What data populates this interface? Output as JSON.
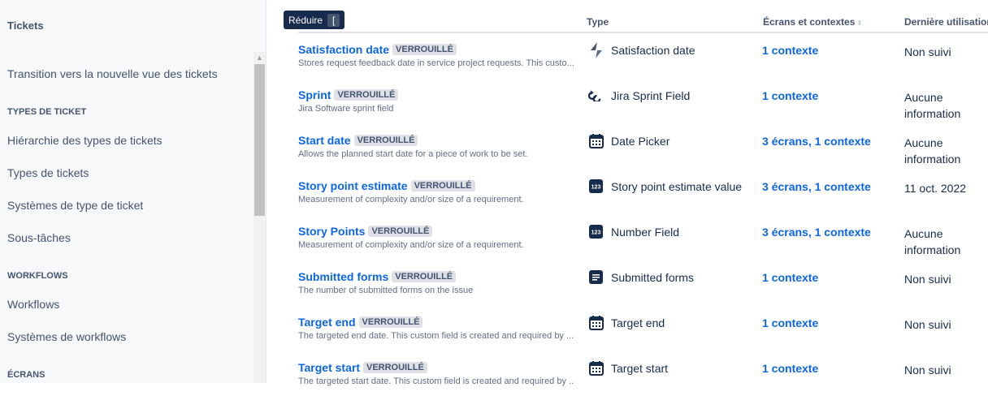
{
  "sidebar": {
    "title": "Tickets",
    "items": [
      "Transition vers la nouvelle vue des tickets"
    ],
    "sections": [
      {
        "heading": "TYPES DE TICKET",
        "items": [
          "Hiérarchie des types de tickets",
          "Types de tickets",
          "Systèmes de type de ticket",
          "Sous-tâches"
        ]
      },
      {
        "heading": "WORKFLOWS",
        "items": [
          "Workflows",
          "Systèmes de workflows"
        ]
      },
      {
        "heading": "ÉCRANS",
        "items": []
      }
    ]
  },
  "collapse": {
    "label": "Réduire",
    "shortcut": "["
  },
  "table": {
    "headers": {
      "type": "Type",
      "screens": "Écrans et contextes",
      "last_used": "Dernière utilisation"
    },
    "locked_label": "VERROUILLÉ",
    "rows": [
      {
        "name": "Satisfaction date",
        "desc": "Stores request feedback date in service project requests. This custo...",
        "type": "Satisfaction date",
        "icon": "lightning-icon",
        "ctx": "1 contexte",
        "last": "Non suivi"
      },
      {
        "name": "Sprint",
        "desc": "Jira Software sprint field",
        "type": "Jira Sprint Field",
        "icon": "sprint-icon",
        "ctx": "1 contexte",
        "last": "Aucune information"
      },
      {
        "name": "Start date",
        "desc": "Allows the planned start date for a piece of work to be set.",
        "type": "Date Picker",
        "icon": "calendar-icon",
        "ctx": "3 écrans, 1 contexte",
        "last": "Aucune information"
      },
      {
        "name": "Story point estimate",
        "desc": "Measurement of complexity and/or size of a requirement.",
        "type": "Story point estimate value",
        "icon": "number-icon",
        "ctx": "3 écrans, 1 contexte",
        "last": "11 oct. 2022"
      },
      {
        "name": "Story Points",
        "desc": "Measurement of complexity and/or size of a requirement.",
        "type": "Number Field",
        "icon": "number-icon",
        "ctx": "3 écrans, 1 contexte",
        "last": "Aucune information"
      },
      {
        "name": "Submitted forms",
        "desc": "The number of submitted forms on the issue",
        "type": "Submitted forms",
        "icon": "form-icon",
        "ctx": "1 contexte",
        "last": "Non suivi"
      },
      {
        "name": "Target end",
        "desc": "The targeted end date. This custom field is created and required by ...",
        "type": "Target end",
        "icon": "calendar-icon",
        "ctx": "1 contexte",
        "last": "Non suivi"
      },
      {
        "name": "Target start",
        "desc": "The targeted start date. This custom field is created and required by ...",
        "type": "Target start",
        "icon": "calendar-icon",
        "ctx": "1 contexte",
        "last": "Non suivi"
      }
    ]
  }
}
